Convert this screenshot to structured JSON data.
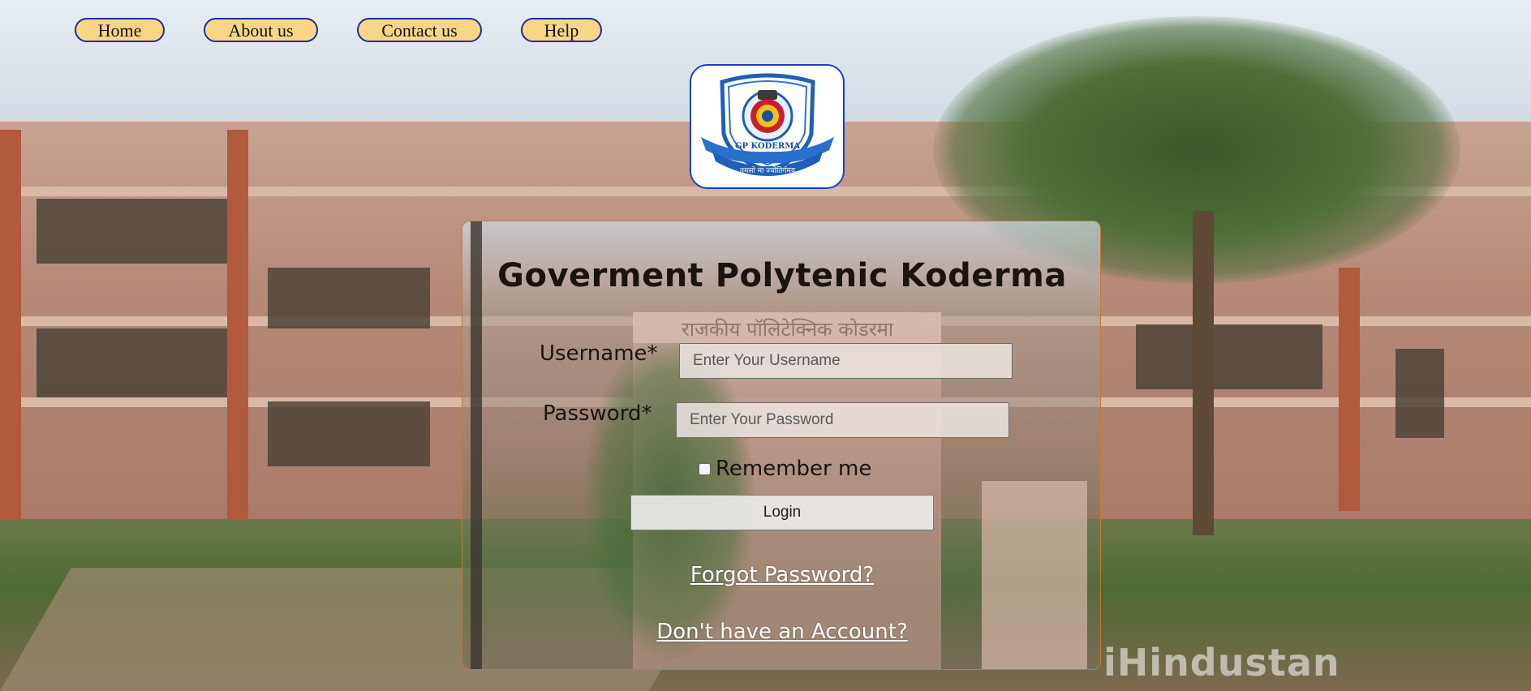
{
  "nav": {
    "items": [
      {
        "label": "Home"
      },
      {
        "label": "About us"
      },
      {
        "label": "Contact us"
      },
      {
        "label": "Help"
      }
    ]
  },
  "logo": {
    "emblem": "GP KODERMA",
    "motto": "तमसो मा ज्योतिर्गमय"
  },
  "card": {
    "title": "Goverment Polytenic Koderma",
    "sign_text": "राजकीय पॉलिटेक्निक कोडरमा",
    "username_label": "Username*",
    "username_placeholder": "Enter Your Username",
    "password_label": "Password*",
    "password_placeholder": "Enter Your Password",
    "remember_label": "Remember me",
    "login_label": "Login",
    "forgot_link": "Forgot Password?",
    "signup_link": "Don't have an Account?"
  },
  "watermark": "iHindustan",
  "colors": {
    "nav_bg": "#fbd586",
    "nav_border": "#1d2f9c",
    "logo_border": "#1a3fc4",
    "card_border": "#c07a3a"
  }
}
